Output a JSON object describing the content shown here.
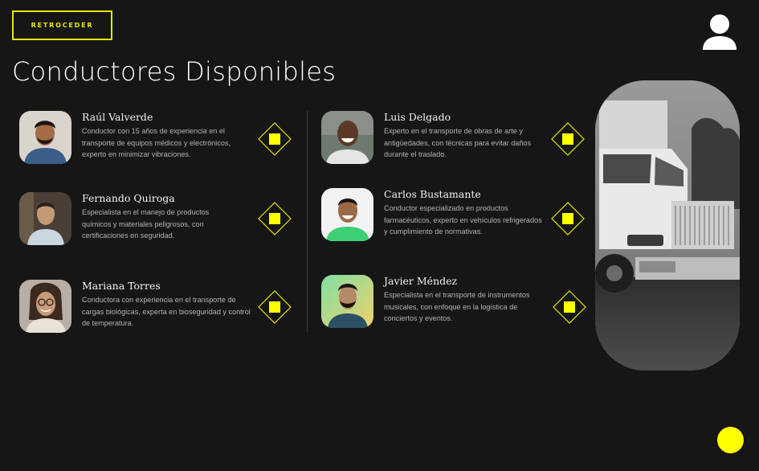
{
  "header": {
    "back_label": "RETROCEDER",
    "title": "Conductores Disponibles"
  },
  "colors": {
    "accent": "#FFFF00",
    "background": "#161616"
  },
  "icons": {
    "profile": "user-icon",
    "select": "diamond-square-icon",
    "fab": "yellow-circle-button"
  },
  "drivers": [
    {
      "name": "Raúl Valverde",
      "description": "Conductor con 15 años de experiencia en el transporte de equipos médicos y electrónicos, experto en minimizar vibraciones."
    },
    {
      "name": "Fernando Quiroga",
      "description": "Especialista en el manejo de productos químicos y materiales peligrosos, con certificaciones en seguridad."
    },
    {
      "name": "Mariana Torres",
      "description": "Conductora con experiencia en el transporte de cargas biológicas, experta en bioseguridad y control de temperatura."
    },
    {
      "name": "Luis Delgado",
      "description": "Experto en el transporte de obras de arte y antigüedades, con técnicas para evitar daños durante el traslado."
    },
    {
      "name": "Carlos Bustamante",
      "description": "Conductor especializado en productos farmacéuticos, experto en vehículos refrigerados y cumplimiento de normativas."
    },
    {
      "name": "Javier Méndez",
      "description": "Especialista en el transporte de instrumentos musicales, con enfoque en la logística de conciertos y eventos."
    }
  ]
}
